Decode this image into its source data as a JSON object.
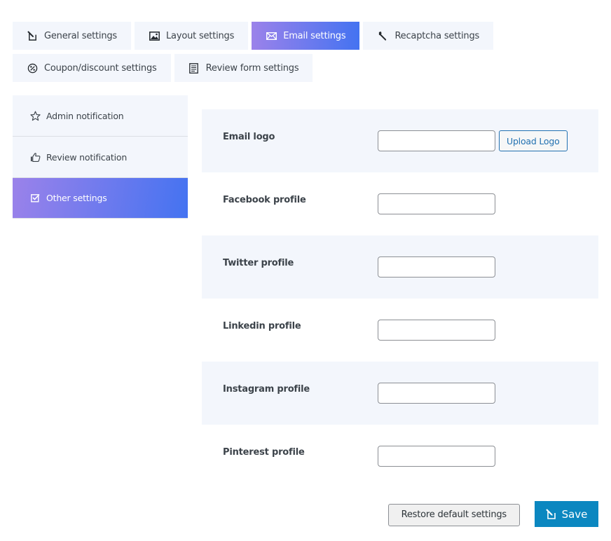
{
  "tabs": {
    "row1": [
      {
        "label": "General settings",
        "icon": "edit-icon",
        "active": false
      },
      {
        "label": "Layout settings",
        "icon": "image-icon",
        "active": false
      },
      {
        "label": "Email settings",
        "icon": "email-icon",
        "active": true
      },
      {
        "label": "Recaptcha settings",
        "icon": "wrench-icon",
        "active": false
      }
    ],
    "row2": [
      {
        "label": "Coupon/discount settings",
        "icon": "discount-icon",
        "active": false
      },
      {
        "label": "Review form settings",
        "icon": "document-icon",
        "active": false
      }
    ]
  },
  "sidebar": {
    "items": [
      {
        "label": "Admin notification",
        "icon": "star-icon",
        "active": false
      },
      {
        "label": "Review notification",
        "icon": "thumbs-up-icon",
        "active": false
      },
      {
        "label": "Other settings",
        "icon": "checkbox-icon",
        "active": true
      }
    ]
  },
  "fields": [
    {
      "label": "Email logo",
      "value": "",
      "button": "Upload Logo"
    },
    {
      "label": "Facebook profile",
      "value": ""
    },
    {
      "label": "Twitter profile",
      "value": ""
    },
    {
      "label": "Linkedin profile",
      "value": ""
    },
    {
      "label": "Instagram profile",
      "value": ""
    },
    {
      "label": "Pinterest profile",
      "value": ""
    }
  ],
  "actions": {
    "restore_label": "Restore default settings",
    "save_label": "Save"
  },
  "colors": {
    "accent_gradient_start": "#9b82ea",
    "accent_gradient_end": "#4473f1",
    "panel_bg": "#f3f6fc",
    "save_bg": "#0b87c0",
    "upload_border": "#2271b1"
  }
}
